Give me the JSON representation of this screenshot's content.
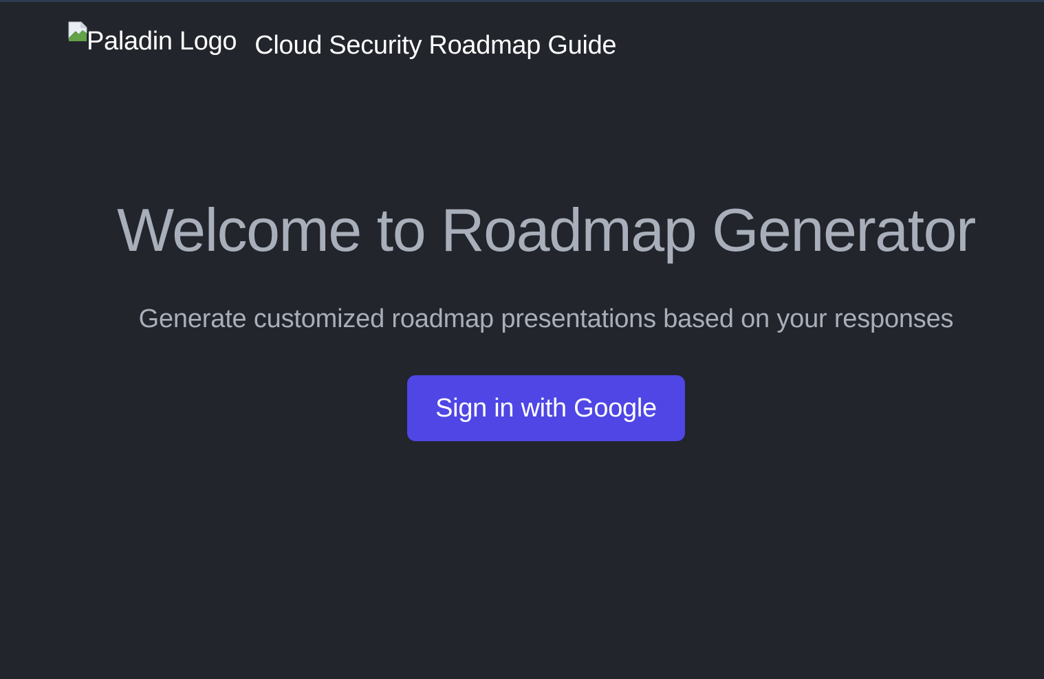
{
  "header": {
    "logo_alt": "Paladin Logo",
    "logo_icon": "broken-image-icon",
    "title": "Cloud Security Roadmap Guide"
  },
  "hero": {
    "title": "Welcome to Roadmap Generator",
    "subtitle": "Generate customized roadmap presentations based on your responses"
  },
  "actions": {
    "sign_in_label": "Sign in with Google"
  },
  "colors": {
    "background": "#22252b",
    "accent": "#4f46e5",
    "muted_text": "#a9afba",
    "text": "#ffffff"
  }
}
